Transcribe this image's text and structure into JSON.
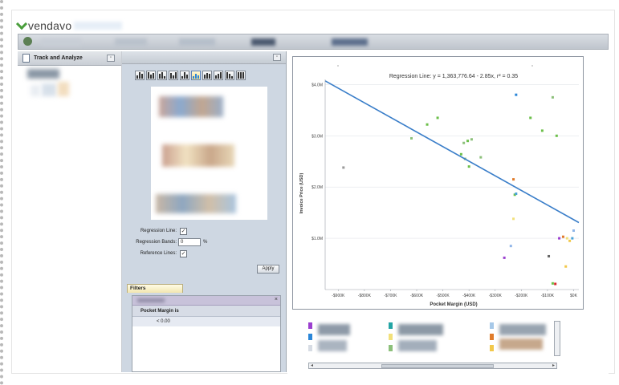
{
  "app": {
    "logo_text": "vendavo"
  },
  "nav": {
    "title": "Track and Analyze"
  },
  "settings": {
    "regression_line_label": "Regression Line:",
    "regression_line_checked": true,
    "regression_bands_label": "Regression Bands:",
    "regression_bands_value": "0",
    "regression_bands_unit": "%",
    "reference_lines_label": "Reference Lines:",
    "reference_lines_checked": true,
    "apply_label": "Apply"
  },
  "filters": {
    "tab_label": "Filters",
    "criteria_label": "Pocket Margin is",
    "criteria_value": "< 0.00",
    "close_glyph": "×"
  },
  "chart_data": {
    "type": "scatter",
    "title": "Regression Line: y = 1,363,776.64 - 2.85x, r² = 0.35",
    "xlabel": "Pocket Margin (USD)",
    "ylabel": "Invoice Price (USD)",
    "xlim": [
      -950000,
      20000
    ],
    "ylim": [
      0,
      4100000
    ],
    "x_ticks": [
      -900000,
      -800000,
      -700000,
      -600000,
      -500000,
      -400000,
      -300000,
      -200000,
      -100000,
      0
    ],
    "x_tick_labels": [
      "-$900K",
      "-$800K",
      "-$700K",
      "-$600K",
      "-$500K",
      "-$400K",
      "-$300K",
      "-$200K",
      "-$100K",
      "$0K"
    ],
    "y_ticks": [
      1000000,
      2000000,
      3000000,
      4000000
    ],
    "y_tick_labels": [
      "$1.0M",
      "$2.0M",
      "$3.0M",
      "$4.0M"
    ],
    "regression": {
      "intercept": 1363776.64,
      "slope": -2.85,
      "color": "#3a7ec9"
    },
    "grid": true,
    "points": [
      {
        "x": -880000,
        "y": 2380000,
        "color": "#9a9a9a"
      },
      {
        "x": -620000,
        "y": 2950000,
        "color": "#8cc07a"
      },
      {
        "x": -560000,
        "y": 3220000,
        "color": "#6cbf4a"
      },
      {
        "x": -520000,
        "y": 3350000,
        "color": "#6cbf4a"
      },
      {
        "x": -420000,
        "y": 2860000,
        "color": "#8cc07a"
      },
      {
        "x": -405000,
        "y": 2900000,
        "color": "#6cbf4a"
      },
      {
        "x": -390000,
        "y": 2930000,
        "color": "#8cc07a"
      },
      {
        "x": -430000,
        "y": 2640000,
        "color": "#6cbf4a"
      },
      {
        "x": -415000,
        "y": 2550000,
        "color": "#8cc07a"
      },
      {
        "x": -355000,
        "y": 2580000,
        "color": "#8cc07a"
      },
      {
        "x": -400000,
        "y": 2400000,
        "color": "#6cbf4a"
      },
      {
        "x": -220000,
        "y": 3800000,
        "color": "#2a86d8"
      },
      {
        "x": -165000,
        "y": 3350000,
        "color": "#6cbf4a"
      },
      {
        "x": -120000,
        "y": 3100000,
        "color": "#6cbf4a"
      },
      {
        "x": -80000,
        "y": 3750000,
        "color": "#8cc07a"
      },
      {
        "x": -65000,
        "y": 3000000,
        "color": "#6cbf4a"
      },
      {
        "x": -230000,
        "y": 2150000,
        "color": "#e07b2a"
      },
      {
        "x": -225000,
        "y": 1850000,
        "color": "#6cbf4a"
      },
      {
        "x": -220000,
        "y": 1870000,
        "color": "#4aa3d8"
      },
      {
        "x": -230000,
        "y": 1380000,
        "color": "#f2e07a"
      },
      {
        "x": -240000,
        "y": 850000,
        "color": "#8fb5e8"
      },
      {
        "x": -265000,
        "y": 620000,
        "color": "#9b3fcf"
      },
      {
        "x": -95000,
        "y": 650000,
        "color": "#666666"
      },
      {
        "x": -55000,
        "y": 1000000,
        "color": "#9b3fcf"
      },
      {
        "x": -40000,
        "y": 1030000,
        "color": "#e07b2a"
      },
      {
        "x": -25000,
        "y": 1000000,
        "color": "#f2e07a"
      },
      {
        "x": -15000,
        "y": 950000,
        "color": "#f2c84a"
      },
      {
        "x": -5000,
        "y": 1000000,
        "color": "#4aa3d8"
      },
      {
        "x": 0,
        "y": 1150000,
        "color": "#8fb5e8"
      },
      {
        "x": -30000,
        "y": 450000,
        "color": "#f2c84a"
      },
      {
        "x": -80000,
        "y": 120000,
        "color": "#6cbf4a"
      },
      {
        "x": -70000,
        "y": 110000,
        "color": "#d62828"
      }
    ]
  },
  "colors": {
    "accent": "#3a7ec9",
    "panel_bg": "#ced7e2",
    "logo_green": "#4a9e3c"
  },
  "icons": {
    "logo": "vendavo-check-icon",
    "home": "home-icon",
    "nav_doc": "document-icon",
    "close": "close-icon"
  }
}
